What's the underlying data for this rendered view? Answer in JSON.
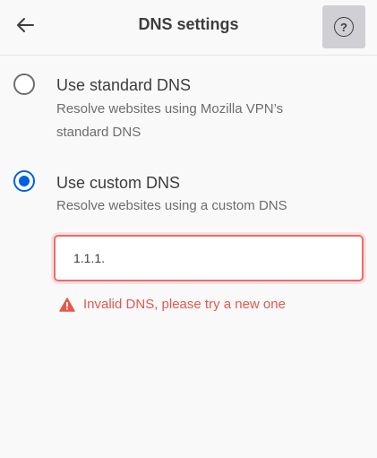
{
  "header": {
    "title": "DNS settings",
    "back_icon": "arrow-left-icon",
    "help_icon": "question-circle-icon",
    "help_glyph": "?"
  },
  "options": [
    {
      "title": "Use standard DNS",
      "description": "Resolve websites using Mozilla VPN’s standard DNS",
      "selected": false
    },
    {
      "title": "Use custom DNS",
      "description": "Resolve websites using a custom DNS",
      "selected": true
    }
  ],
  "custom_dns": {
    "value": "1.1.1.",
    "error": "Invalid DNS, please try a new one",
    "error_icon": "warning-triangle-icon"
  },
  "colors": {
    "accent": "#0060df",
    "error": "#e5584e",
    "help_button_bg": "#cfcfd4"
  }
}
